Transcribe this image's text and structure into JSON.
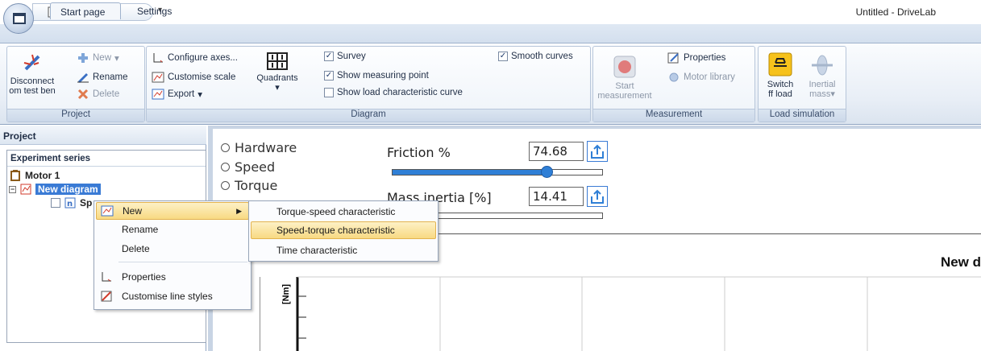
{
  "window": {
    "title": "Untitled - DriveLab"
  },
  "tabs": [
    {
      "label": "Start page"
    },
    {
      "label": "Settings"
    }
  ],
  "ribbon": {
    "project": {
      "title": "Project",
      "disconnect_label_1": "Disconnect",
      "disconnect_label_2": "om test ben",
      "new_label": "New",
      "rename_label": "Rename",
      "delete_label": "Delete"
    },
    "diagram": {
      "title": "Diagram",
      "configure_axes": "Configure axes...",
      "customise_scale": "Customise scale",
      "export": "Export",
      "quadrants": "Quadrants",
      "survey": {
        "label": "Survey",
        "checked": true
      },
      "show_measuring_point": {
        "label": "Show measuring point",
        "checked": true
      },
      "show_load_curve": {
        "label": "Show load characteristic curve",
        "checked": false
      },
      "smooth_curves": {
        "label": "Smooth curves",
        "checked": true
      }
    },
    "measurement": {
      "title": "Measurement",
      "start_label_1": "Start",
      "start_label_2": "measurement",
      "properties": "Properties",
      "motor_library": "Motor library"
    },
    "load_simulation": {
      "title": "Load simulation",
      "switch_label_1": "Switch",
      "switch_label_2": "ff load",
      "inertial_label_1": "Inertial",
      "inertial_label_2": "mass"
    }
  },
  "project_pane": {
    "header": "Project",
    "experiment_series": "Experiment series",
    "motor": "Motor 1",
    "diagram": "New diagram",
    "child": "Sp"
  },
  "params": {
    "radios": [
      "Hardware",
      "Speed",
      "Torque"
    ],
    "friction": {
      "label": "Friction %",
      "value": "74.68",
      "fraction": 0.74
    },
    "mass_inertia": {
      "label": "Mass inertia [%]",
      "value": "14.41",
      "fraction": 0.0
    }
  },
  "chart": {
    "title": "New d",
    "ylabel": "[Nm]"
  },
  "context_menu": {
    "items": [
      {
        "label": "New"
      },
      {
        "label": "Rename"
      },
      {
        "label": "Delete"
      },
      {
        "label": "Properties"
      },
      {
        "label": "Customise line styles"
      }
    ]
  },
  "submenu": {
    "items": [
      {
        "label": "Torque-speed characteristic"
      },
      {
        "label": "Speed-torque characteristic"
      },
      {
        "label": "Time characteristic"
      }
    ]
  }
}
